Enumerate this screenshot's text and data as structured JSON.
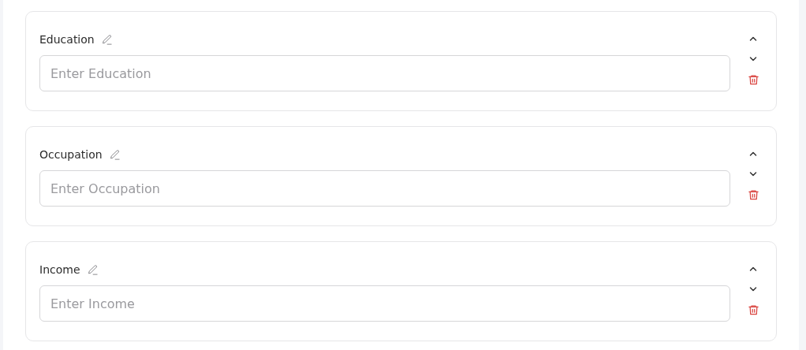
{
  "fields": [
    {
      "label": "Education",
      "placeholder": "Enter Education"
    },
    {
      "label": "Occupation",
      "placeholder": "Enter Occupation"
    },
    {
      "label": "Income",
      "placeholder": "Enter Income"
    }
  ]
}
